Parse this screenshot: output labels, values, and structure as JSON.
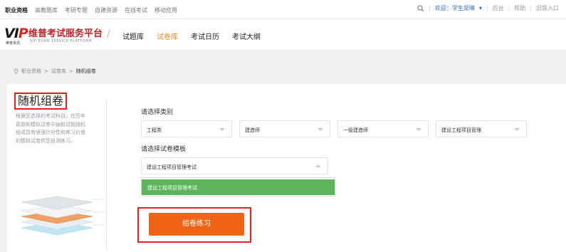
{
  "topbar": {
    "links": [
      "职业资格",
      "高教题库",
      "考研专题",
      "自建资源",
      "在线考试",
      "移动应用"
    ],
    "welcome": "欢迎：学生吴晴",
    "backend": "后台",
    "help": "帮助",
    "old_version": "旧版入口"
  },
  "header": {
    "logo_mark": "VIP",
    "logo_tiny": "维普资讯",
    "brand_cn": "维普考试服务平台",
    "brand_en": "VIP EXAM SERVICE PLATFORM",
    "nav": [
      "试题库",
      "试卷库",
      "考试日历",
      "考试大纲"
    ],
    "active_nav": "试卷库"
  },
  "breadcrumb": {
    "items": [
      "职业资格",
      "试卷库"
    ],
    "current": "随机组卷",
    "separator": ">"
  },
  "sidebar": {
    "title": "随机组卷",
    "description": "根据您选择的考试科目，在历年真题和模拟试卷中抽取试题随机组成具有很强针对性和练习价值的模拟试卷供您自测练习。"
  },
  "form": {
    "category_label": "请选择类别",
    "category_selects": [
      "工程类",
      "建造师",
      "一级建造师",
      "建设工程项目管理"
    ],
    "template_label": "请选择试卷模板",
    "template_value": "建设工程项目管理考试",
    "dropdown_option": "建设工程项目管理考试",
    "submit_label": "组卷练习"
  },
  "colors": {
    "accent_orange": "#f06418",
    "nav_active": "#f08a24",
    "highlight_green": "#5cb45c",
    "annotation_red": "#e02020"
  }
}
